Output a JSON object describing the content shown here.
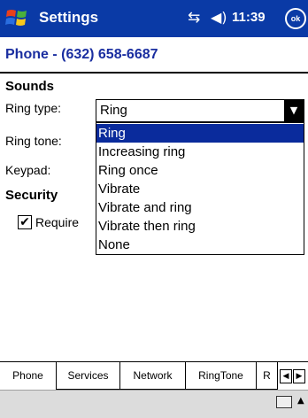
{
  "titlebar": {
    "title": "Settings",
    "time": "11:39",
    "ok_label": "ok",
    "start_icon": "windows-flag-icon",
    "sync_icon": "connectivity-icon",
    "volume_icon": "speaker-icon"
  },
  "header": {
    "phone_line": "Phone - (632) 658-6687"
  },
  "sounds": {
    "heading": "Sounds",
    "ring_type_label": "Ring type:",
    "ring_tone_label": "Ring tone:",
    "keypad_label": "Keypad:",
    "ring_type_value": "Ring",
    "options": [
      "Ring",
      "Increasing ring",
      "Ring once",
      "Vibrate",
      "Vibrate and ring",
      "Vibrate then ring",
      "None"
    ],
    "selected_index": 0
  },
  "security": {
    "heading": "Security",
    "require_label": "Require",
    "require_checked": true
  },
  "tabs": [
    "Phone",
    "Services",
    "Network",
    "RingTone",
    "R"
  ],
  "active_tab": "Phone",
  "colors": {
    "titlebar": "#0a3aa6",
    "header_text": "#1a2ea0",
    "selection": "#0a2b9c"
  }
}
